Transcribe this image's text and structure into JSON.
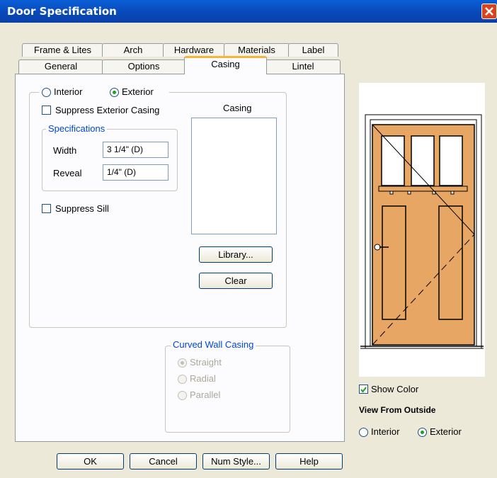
{
  "window": {
    "title": "Door Specification",
    "close_icon": "close-icon"
  },
  "tabs": {
    "row1": [
      "Frame & Lites",
      "Arch",
      "Hardware",
      "Materials",
      "Label"
    ],
    "row2": [
      "General",
      "Options",
      "Casing",
      "Lintel"
    ],
    "active": "Casing"
  },
  "casing": {
    "side_interior": "Interior",
    "side_exterior": "Exterior",
    "selected_side": "Exterior",
    "suppress_exterior_casing": "Suppress Exterior Casing",
    "suppress_exterior_casing_checked": false,
    "specifications_legend": "Specifications",
    "width_label": "Width",
    "width_value": "3 1/4\" (D)",
    "reveal_label": "Reveal",
    "reveal_value": "1/4\" (D)",
    "suppress_sill": "Suppress Sill",
    "suppress_sill_checked": false,
    "list_title": "Casing",
    "library_button": "Library...",
    "clear_button": "Clear",
    "curved_legend": "Curved Wall Casing",
    "curved_options": [
      "Straight",
      "Radial",
      "Parallel"
    ],
    "curved_selected": "Straight"
  },
  "preview": {
    "show_color": "Show Color",
    "show_color_checked": true,
    "view_from_outside": "View From Outside",
    "view_interior": "Interior",
    "view_exterior": "Exterior",
    "view_selected": "Exterior",
    "door_color": "#e8a664",
    "check_color": "#21a121"
  },
  "footer": {
    "ok": "OK",
    "cancel": "Cancel",
    "num_style": "Num Style...",
    "help": "Help"
  }
}
